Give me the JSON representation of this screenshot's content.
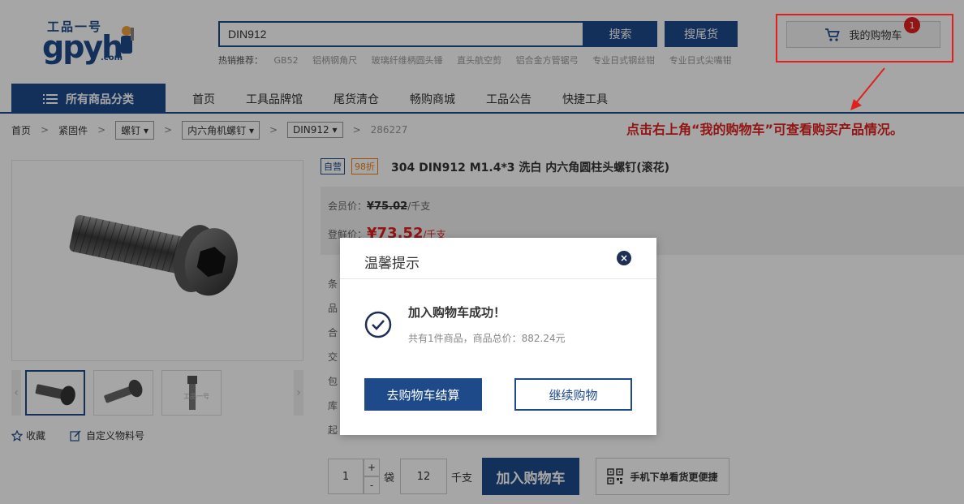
{
  "header": {
    "logo_top": "工品一号",
    "logo_main": "gpyh",
    "logo_com": ".com",
    "search_value": "DIN912",
    "search_button": "搜索",
    "tail_button": "搜尾货",
    "hot_label": "热销推荐：",
    "hot_items": [
      "GB52",
      "铝柄钢角尺",
      "玻璃纤维柄圆头锤",
      "直头航空剪",
      "铝合金方管锯弓",
      "专业日式钢丝钳",
      "专业日式尖嘴钳"
    ],
    "cart_label": "我的购物车",
    "cart_count": "1"
  },
  "nav": {
    "category": "所有商品分类",
    "items": [
      "首页",
      "工具品牌馆",
      "尾货清仓",
      "畅购商城",
      "工品公告",
      "快捷工具"
    ]
  },
  "breadcrumb": {
    "home": "首页",
    "level1": "紧固件",
    "level2": "螺钉",
    "level3": "内六角机螺钉",
    "level4": "DIN912",
    "sku": "286227"
  },
  "annotation": "点击右上角“我的购物车”可查看购买产品情况。",
  "product": {
    "tag_self": "自营",
    "tag_discount": "98折",
    "title": "304  DIN912  M1.4*3  洗白  内六角圆柱头螺钉(滚花)",
    "member_label": "会员价：",
    "member_price": "¥75.02",
    "member_unit": "/千支",
    "sale_label": "登鲜价：",
    "sale_price": "¥73.52",
    "sale_unit": "/千支",
    "attrs": [
      "条",
      "品",
      "合",
      "交",
      "包",
      "库",
      "起"
    ],
    "thumb3_text": "工品一号"
  },
  "gallery": {
    "favorite": "收藏",
    "custom": "自定义物料号",
    "prev": "‹",
    "next": "›"
  },
  "purchase": {
    "qty": "1",
    "plus": "+",
    "minus": "-",
    "unit_bag": "袋",
    "qty2": "12",
    "unit_k": "千支",
    "add_cart": "加入购物车",
    "mobile": "手机下单看货更便捷"
  },
  "modal": {
    "title": "温馨提示",
    "close": "×",
    "success_title": "加入购物车成功！",
    "success_sub": "共有1件商品，商品总价：882.24元",
    "checkout": "去购物车结算",
    "continue": "继续购物"
  },
  "colors": {
    "brand": "#1e4a8a",
    "alert": "#e02020",
    "discount": "#f08010"
  }
}
